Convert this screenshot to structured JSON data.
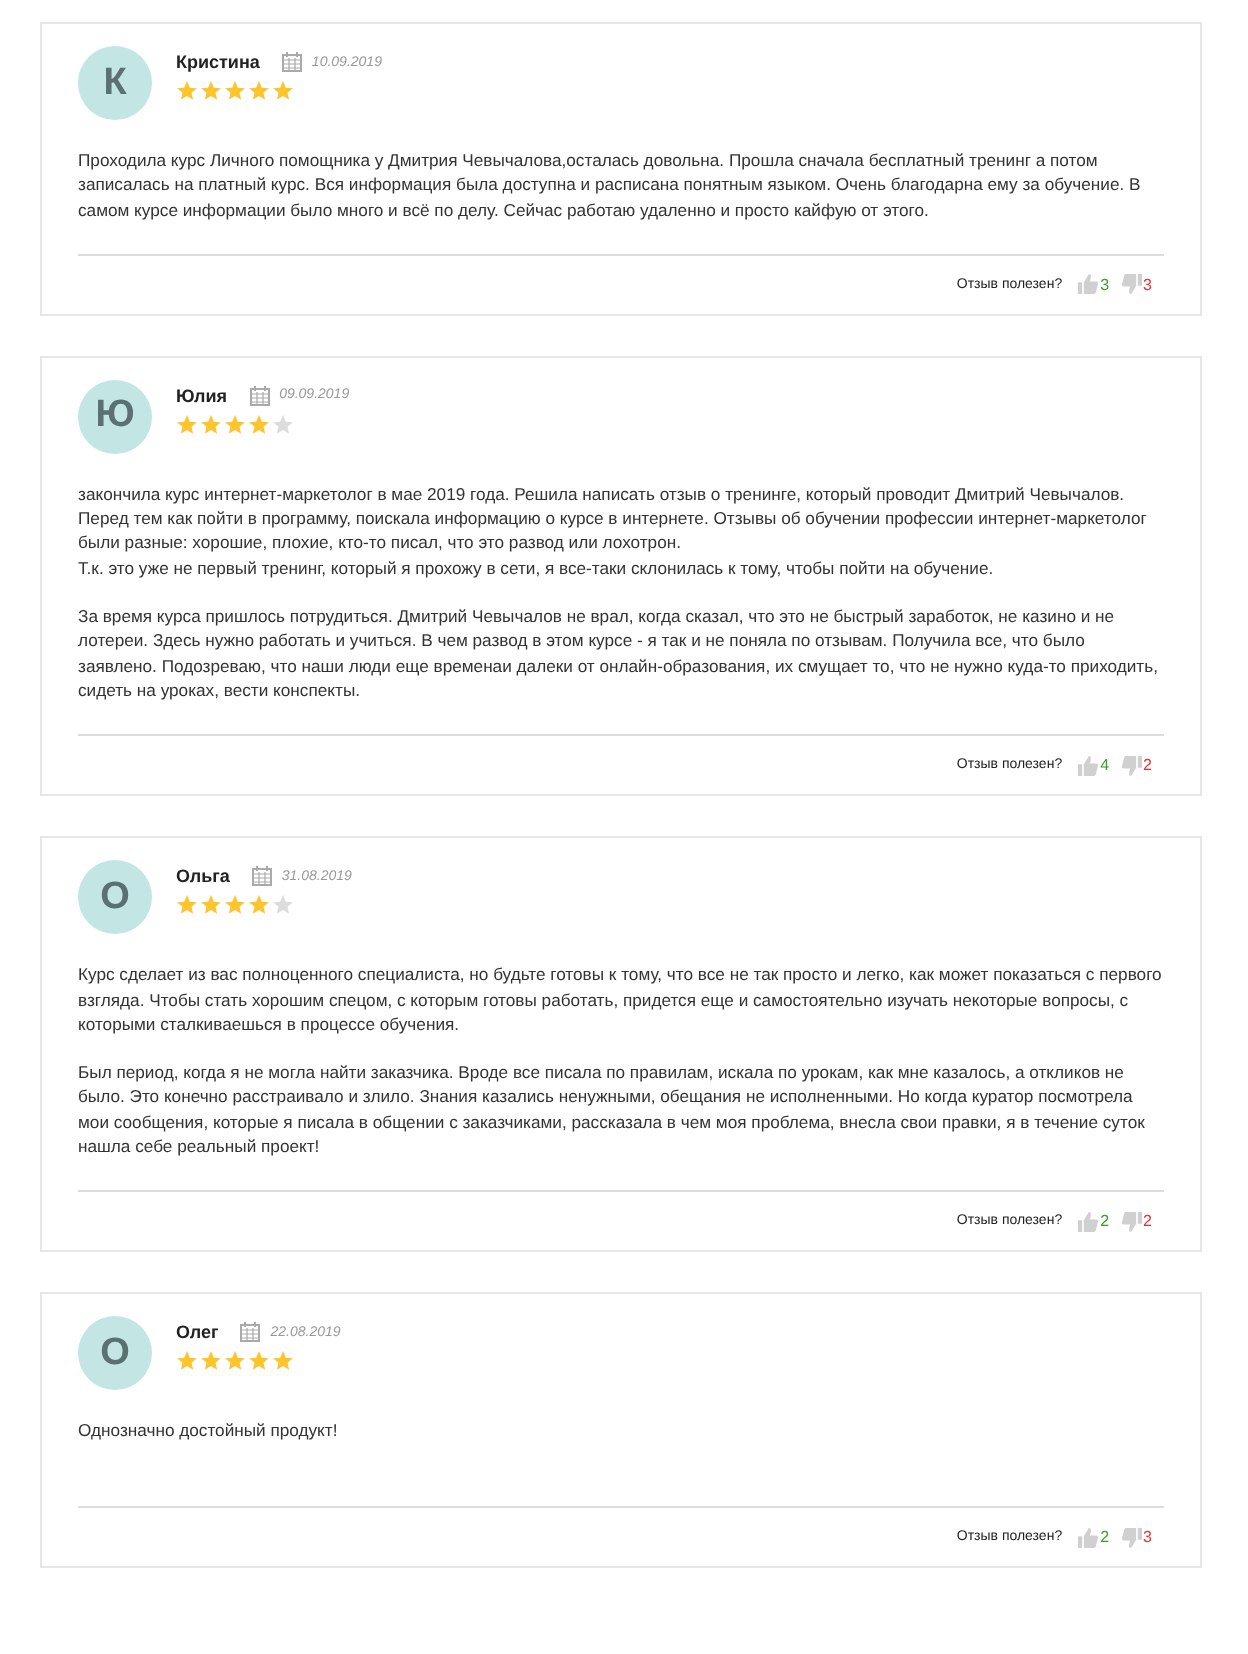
{
  "reviews": [
    {
      "initial": "К",
      "name": "Кристина",
      "date": "10.09.2019",
      "stars": 5,
      "paragraphs": [
        [
          "Проходила курс Личного помощника у Дмитрия Чевычалова,осталась довольна. Прошла сначала бесплатный тренинг а потом записалась на платный курс. Вся информация была доступна и расписана понятным языком. Очень благодарна ему за обучение. В самом курсе информации было много и всё по делу. Сейчас работаю удаленно и просто кайфую от этого."
        ]
      ],
      "helpful_label": "Отзыв полезен?",
      "likes": "3",
      "dislikes": "3"
    },
    {
      "initial": "Ю",
      "name": "Юлия",
      "date": "09.09.2019",
      "stars": 4,
      "paragraphs": [
        [
          "закончила курс интернет-маркетолог в мае 2019 года. Решила написать отзыв о тренинге, который проводит Дмитрий Чевычалов. Перед тем как пойти в программу, поискала информацию о курсе в интернете. Отзывы об обучении профессии интернет-маркетолог были разные: хорошие, плохие, кто-то писал, что это развод или лохотрон.",
          "Т.к. это уже не первый тренинг, который я прохожу в сети, я все-таки склонилась к тому, чтобы пойти на обучение."
        ],
        [
          "За время курса пришлось потрудиться. Дмитрий Чевычалов не врал, когда сказал, что это не быстрый заработок, не казино и не лотереи. Здесь нужно работать и учиться. В чем развод в этом курсе - я так и не поняла по отзывам. Получила все, что было заявлено. Подозреваю, что наши люди еще временаи далеки от онлайн-образования, их смущает то, что не нужно куда-то приходить, сидеть на уроках, вести конспекты."
        ]
      ],
      "helpful_label": "Отзыв полезен?",
      "likes": "4",
      "dislikes": "2"
    },
    {
      "initial": "О",
      "name": "Ольга",
      "date": "31.08.2019",
      "stars": 4,
      "paragraphs": [
        [
          "Курс сделает из вас полноценного специалиста, но будьте готовы к тому, что все не так просто и легко, как может показаться с первого взгляда. Чтобы стать хорошим спецом, с которым готовы работать, придется еще и самостоятельно изучать некоторые вопросы, с которыми сталкиваешься в процессе обучения."
        ],
        [
          "Был период, когда я не могла найти заказчика. Вроде все писала по правилам, искала по урокам, как мне казалось, а откликов не было. Это конечно расстраивало и злило. Знания казались ненужными, обещания не исполненными. Но когда куратор посмотрела мои сообщения, которые я писала в общении с заказчиками, рассказала в чем моя проблема, внесла свои правки, я в течение суток нашла себе реальный проект!"
        ]
      ],
      "helpful_label": "Отзыв полезен?",
      "likes": "2",
      "dislikes": "2"
    },
    {
      "initial": "О",
      "name": "Олег",
      "date": "22.08.2019",
      "stars": 5,
      "paragraphs": [
        [
          "Однозначно достойный продукт!"
        ]
      ],
      "helpful_label": "Отзыв полезен?",
      "likes": "2",
      "dislikes": "3"
    }
  ]
}
